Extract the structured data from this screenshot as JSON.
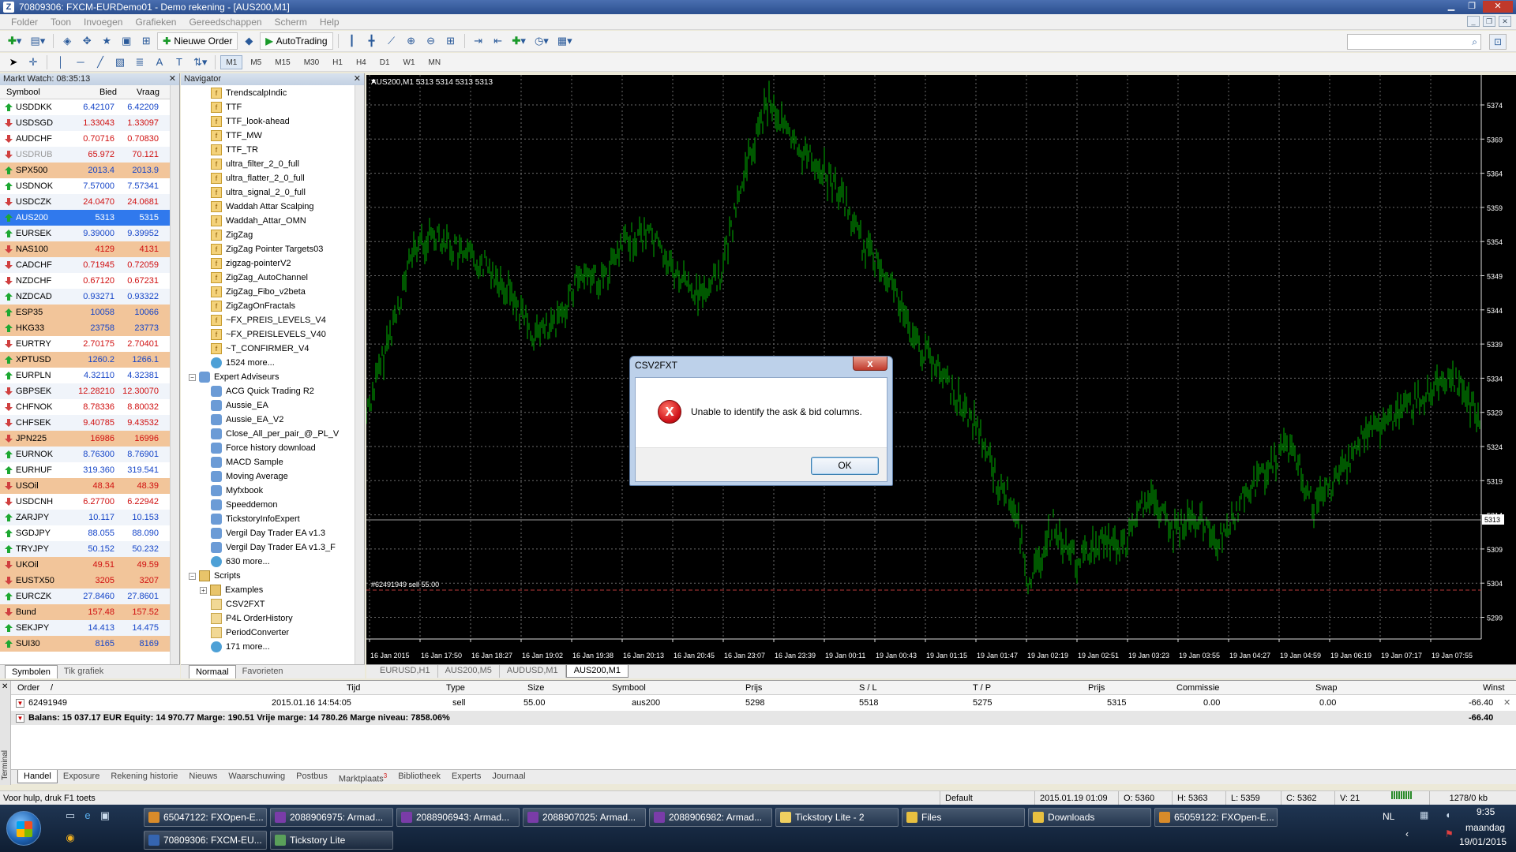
{
  "window": {
    "title": "70809306: FXCM-EURDemo01 - Demo rekening - [AUS200,M1]",
    "app_icon_letter": "Z"
  },
  "menu": [
    "Folder",
    "Toon",
    "Invoegen",
    "Grafieken",
    "Gereedschappen",
    "Scherm",
    "Help"
  ],
  "toolbar": {
    "new_order_label": "Nieuwe Order",
    "autotrading_label": "AutoTrading",
    "timeframes": [
      "M1",
      "M5",
      "M15",
      "M30",
      "H1",
      "H4",
      "D1",
      "W1",
      "MN"
    ],
    "active_timeframe": "M1"
  },
  "market_watch": {
    "title": "Markt Watch: 08:35:13",
    "col_symbol": "Symbool",
    "col_bid": "Bied",
    "col_ask": "Vraag",
    "rows": [
      {
        "symbol": "USDDKK",
        "bid": "6.42107",
        "ask": "6.42209",
        "dir": "up",
        "style": "even"
      },
      {
        "symbol": "USDSGD",
        "bid": "1.33043",
        "ask": "1.33097",
        "dir": "down",
        "style": "odd"
      },
      {
        "symbol": "AUDCHF",
        "bid": "0.70716",
        "ask": "0.70830",
        "dir": "down",
        "style": "even"
      },
      {
        "symbol": "USDRUB",
        "bid": "65.972",
        "ask": "70.121",
        "dir": "down",
        "style": "odd grey"
      },
      {
        "symbol": "SPX500",
        "bid": "2013.4",
        "ask": "2013.9",
        "dir": "up",
        "style": "orange"
      },
      {
        "symbol": "USDNOK",
        "bid": "7.57000",
        "ask": "7.57341",
        "dir": "up",
        "style": "even"
      },
      {
        "symbol": "USDCZK",
        "bid": "24.0470",
        "ask": "24.0681",
        "dir": "down",
        "style": "odd"
      },
      {
        "symbol": "AUS200",
        "bid": "5313",
        "ask": "5315",
        "dir": "up",
        "style": "selected"
      },
      {
        "symbol": "EURSEK",
        "bid": "9.39000",
        "ask": "9.39952",
        "dir": "up",
        "style": "odd"
      },
      {
        "symbol": "NAS100",
        "bid": "4129",
        "ask": "4131",
        "dir": "down",
        "style": "orange"
      },
      {
        "symbol": "CADCHF",
        "bid": "0.71945",
        "ask": "0.72059",
        "dir": "down",
        "style": "odd"
      },
      {
        "symbol": "NZDCHF",
        "bid": "0.67120",
        "ask": "0.67231",
        "dir": "down",
        "style": "even"
      },
      {
        "symbol": "NZDCAD",
        "bid": "0.93271",
        "ask": "0.93322",
        "dir": "up",
        "style": "odd"
      },
      {
        "symbol": "ESP35",
        "bid": "10058",
        "ask": "10066",
        "dir": "up",
        "style": "orange"
      },
      {
        "symbol": "HKG33",
        "bid": "23758",
        "ask": "23773",
        "dir": "up",
        "style": "orange"
      },
      {
        "symbol": "EURTRY",
        "bid": "2.70175",
        "ask": "2.70401",
        "dir": "down",
        "style": "even"
      },
      {
        "symbol": "XPTUSD",
        "bid": "1260.2",
        "ask": "1266.1",
        "dir": "up",
        "style": "orange"
      },
      {
        "symbol": "EURPLN",
        "bid": "4.32110",
        "ask": "4.32381",
        "dir": "up",
        "style": "even"
      },
      {
        "symbol": "GBPSEK",
        "bid": "12.28210",
        "ask": "12.30070",
        "dir": "down",
        "style": "odd"
      },
      {
        "symbol": "CHFNOK",
        "bid": "8.78336",
        "ask": "8.80032",
        "dir": "down",
        "style": "even"
      },
      {
        "symbol": "CHFSEK",
        "bid": "9.40785",
        "ask": "9.43532",
        "dir": "down",
        "style": "odd"
      },
      {
        "symbol": "JPN225",
        "bid": "16986",
        "ask": "16996",
        "dir": "down",
        "style": "orange"
      },
      {
        "symbol": "EURNOK",
        "bid": "8.76300",
        "ask": "8.76901",
        "dir": "up",
        "style": "odd"
      },
      {
        "symbol": "EURHUF",
        "bid": "319.360",
        "ask": "319.541",
        "dir": "up",
        "style": "even"
      },
      {
        "symbol": "USOil",
        "bid": "48.34",
        "ask": "48.39",
        "dir": "down",
        "style": "orange"
      },
      {
        "symbol": "USDCNH",
        "bid": "6.27700",
        "ask": "6.22942",
        "dir": "down",
        "style": "even"
      },
      {
        "symbol": "ZARJPY",
        "bid": "10.117",
        "ask": "10.153",
        "dir": "up",
        "style": "odd"
      },
      {
        "symbol": "SGDJPY",
        "bid": "88.055",
        "ask": "88.090",
        "dir": "up",
        "style": "even"
      },
      {
        "symbol": "TRYJPY",
        "bid": "50.152",
        "ask": "50.232",
        "dir": "up",
        "style": "odd"
      },
      {
        "symbol": "UKOil",
        "bid": "49.51",
        "ask": "49.59",
        "dir": "down",
        "style": "orange"
      },
      {
        "symbol": "EUSTX50",
        "bid": "3205",
        "ask": "3207",
        "dir": "down",
        "style": "orange"
      },
      {
        "symbol": "EURCZK",
        "bid": "27.8460",
        "ask": "27.8601",
        "dir": "up",
        "style": "odd"
      },
      {
        "symbol": "Bund",
        "bid": "157.48",
        "ask": "157.52",
        "dir": "down",
        "style": "orange"
      },
      {
        "symbol": "SEKJPY",
        "bid": "14.413",
        "ask": "14.475",
        "dir": "up",
        "style": "odd"
      },
      {
        "symbol": "SUI30",
        "bid": "8165",
        "ask": "8169",
        "dir": "up",
        "style": "orange"
      }
    ],
    "tabs": [
      "Symbolen",
      "Tik grafiek"
    ]
  },
  "navigator": {
    "title": "Navigator",
    "indicators": [
      "TrendscalpIndic",
      "TTF",
      "TTF_look-ahead",
      "TTF_MW",
      "TTF_TR",
      "ultra_filter_2_0_full",
      "ultra_flatter_2_0_full",
      "ultra_signal_2_0_full",
      "Waddah Attar Scalping",
      "Waddah_Attar_OMN",
      "ZigZag",
      "ZigZag Pointer Targets03",
      "zigzag-pointerV2",
      "ZigZag_AutoChannel",
      "ZigZag_Fibo_v2beta",
      "ZigZagOnFractals",
      "~FX_PREIS_LEVELS_V4",
      "~FX_PREISLEVELS_V40",
      "~T_CONFIRMER_V4"
    ],
    "indicators_more": "1524 more...",
    "ea_folder": "Expert Adviseurs",
    "experts": [
      "ACG Quick Trading R2",
      "Aussie_EA",
      "Aussie_EA_V2",
      "Close_All_per_pair_@_PL_V",
      "Force history download",
      "MACD Sample",
      "Moving Average",
      "Myfxbook",
      "Speeddemon",
      "TickstoryInfoExpert",
      "Vergil Day Trader EA v1.3",
      "Vergil Day Trader EA v1.3_F"
    ],
    "experts_more": "630 more...",
    "scripts_folder": "Scripts",
    "scripts_sub": "Examples",
    "scripts": [
      "CSV2FXT",
      "P4L OrderHistory",
      "PeriodConverter"
    ],
    "scripts_more": "171 more...",
    "tabs": [
      "Normaal",
      "Favorieten"
    ]
  },
  "chart": {
    "header": "AUS200,M1  5313 5314 5313 5313",
    "order_label": "#62491949 sell 55.00",
    "current_price": "5313",
    "bg_color": "#000000",
    "candle_color": "#00b000",
    "price_ticks": [
      "5374",
      "5369",
      "5364",
      "5359",
      "5354",
      "5349",
      "5344",
      "5339",
      "5334",
      "5329",
      "5324",
      "5319",
      "5314",
      "5309",
      "5304",
      "5299"
    ],
    "time_ticks": [
      "16 Jan 2015",
      "16 Jan 17:50",
      "16 Jan 18:27",
      "16 Jan 19:02",
      "16 Jan 19:38",
      "16 Jan 20:13",
      "16 Jan 20:45",
      "16 Jan 23:07",
      "16 Jan 23:39",
      "19 Jan 00:11",
      "19 Jan 00:43",
      "19 Jan 01:15",
      "19 Jan 01:47",
      "19 Jan 02:19",
      "19 Jan 02:51",
      "19 Jan 03:23",
      "19 Jan 03:55",
      "19 Jan 04:27",
      "19 Jan 04:59",
      "19 Jan 06:19",
      "19 Jan 07:17",
      "19 Jan 07:55"
    ],
    "tabs": [
      "EURUSD,H1",
      "AUS200,M5",
      "AUDUSD,M1",
      "AUS200,M1"
    ],
    "active_tab": "AUS200,M1"
  },
  "terminal": {
    "side_label": "Terminal",
    "headers": {
      "order": "Order",
      "sort": "/",
      "time": "Tijd",
      "type": "Type",
      "size": "Size",
      "symbol": "Symbool",
      "price": "Prijs",
      "sl": "S / L",
      "tp": "T / P",
      "price2": "Prijs",
      "commission": "Commissie",
      "swap": "Swap",
      "profit": "Winst"
    },
    "order": {
      "id": "62491949",
      "time": "2015.01.16 14:54:05",
      "type": "sell",
      "size": "55.00",
      "symbol": "aus200",
      "price": "5298",
      "sl": "5518",
      "tp": "5275",
      "price2": "5315",
      "commission": "0.00",
      "swap": "0.00",
      "profit": "-66.40"
    },
    "balance_text": "Balans: 15 037.17 EUR  Equity: 14 970.77  Marge: 190.51  Vrije marge: 14 780.26  Marge niveau: 7858.06%",
    "balance_profit": "-66.40",
    "tabs": [
      {
        "label": "Handel",
        "badge": ""
      },
      {
        "label": "Exposure",
        "badge": ""
      },
      {
        "label": "Rekening historie",
        "badge": ""
      },
      {
        "label": "Nieuws",
        "badge": ""
      },
      {
        "label": "Waarschuwing",
        "badge": ""
      },
      {
        "label": "Postbus",
        "badge": ""
      },
      {
        "label": "Marktplaats",
        "badge": "3"
      },
      {
        "label": "Bibliotheek",
        "badge": ""
      },
      {
        "label": "Experts",
        "badge": ""
      },
      {
        "label": "Journaal",
        "badge": ""
      }
    ]
  },
  "status": {
    "help": "Voor hulp, druk F1 toets",
    "profile": "Default",
    "datetime": "2015.01.19 01:09",
    "open": "O: 5360",
    "high": "H: 5363",
    "low": "L: 5359",
    "close": "C: 5362",
    "volume": "V: 21",
    "traffic": "1278/0 kb"
  },
  "dialog": {
    "title": "CSV2FXT",
    "close_label": "x",
    "message": "Unable to identify the ask & bid columns.",
    "error_glyph": "x",
    "ok_label": "OK"
  },
  "taskbar": {
    "tasks_row1": [
      "65047122: FXOpen-E...",
      "2088906975: Armad...",
      "2088906943: Armad...",
      "2088907025: Armad...",
      "2088906982: Armad...",
      "Tickstory Lite - 2",
      "Files",
      "Downloads",
      "65059122: FXOpen-E..."
    ],
    "tasks_row2": [
      "70809306: FXCM-EU...",
      "Tickstory Lite"
    ],
    "lang": "NL",
    "time": "9:35",
    "day": "maandag",
    "date": "19/01/2015"
  }
}
